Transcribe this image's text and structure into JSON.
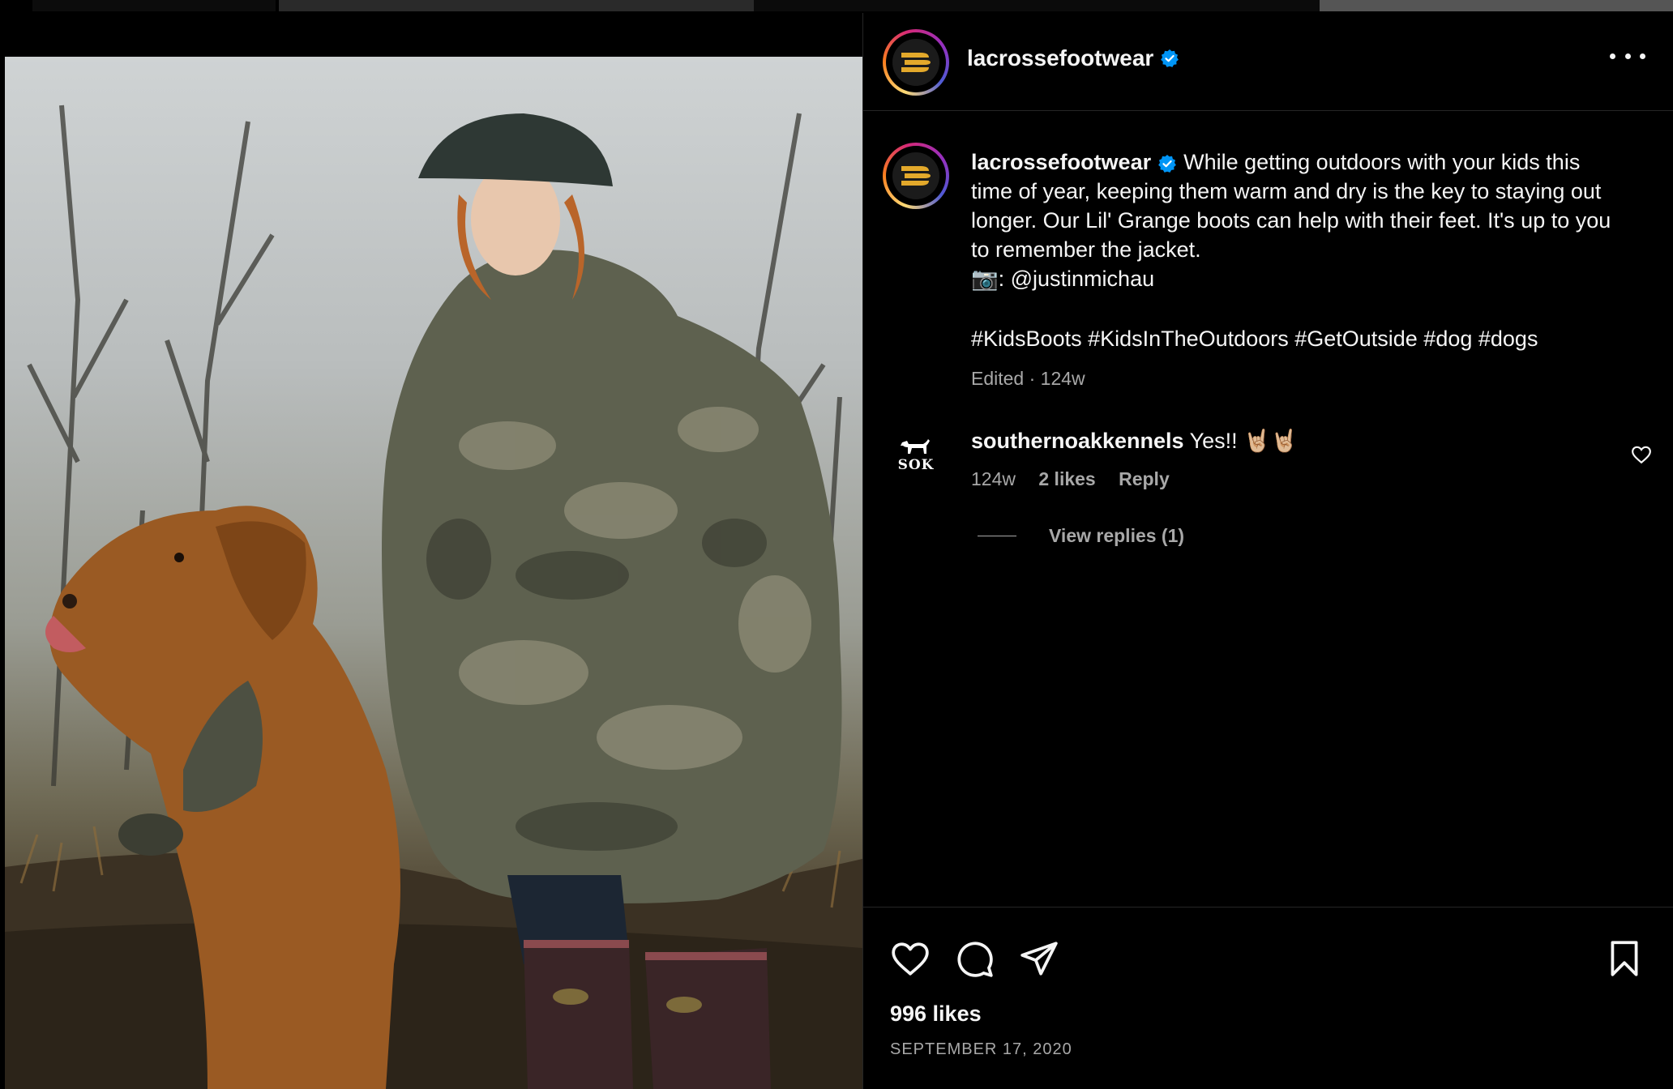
{
  "post": {
    "account": {
      "username": "lacrossefootwear",
      "verified": true
    },
    "caption": {
      "text": "While getting outdoors with your kids this time of year, keeping them warm and dry is the key to staying out longer. Our Lil' Grange boots can help with their feet. It's up to you to remember the jacket.",
      "credit": "📷: @justinmichau",
      "hashtags": "#KidsBoots #KidsInTheOutdoors #GetOutside #dog #dogs",
      "meta": "Edited · 124w"
    },
    "comments": [
      {
        "username": "southernoakkennels",
        "avatar_text": "SOK",
        "text": "Yes!! 🤘🏼🤘🏼",
        "time": "124w",
        "likes": "2 likes",
        "reply_label": "Reply",
        "view_replies": "View replies (1)"
      }
    ],
    "likes": "996 likes",
    "date": "SEPTEMBER 17, 2020"
  },
  "colors": {
    "background": "#000000",
    "text": "#f5f5f5",
    "muted": "#a8a8a8",
    "verified": "#0095f6",
    "brand_logo": "#e3a92b"
  },
  "icons": {
    "more": "ellipsis-icon",
    "like": "heart-icon",
    "comment": "comment-icon",
    "share": "paper-plane-icon",
    "save": "bookmark-icon",
    "verified": "verified-badge-icon"
  }
}
